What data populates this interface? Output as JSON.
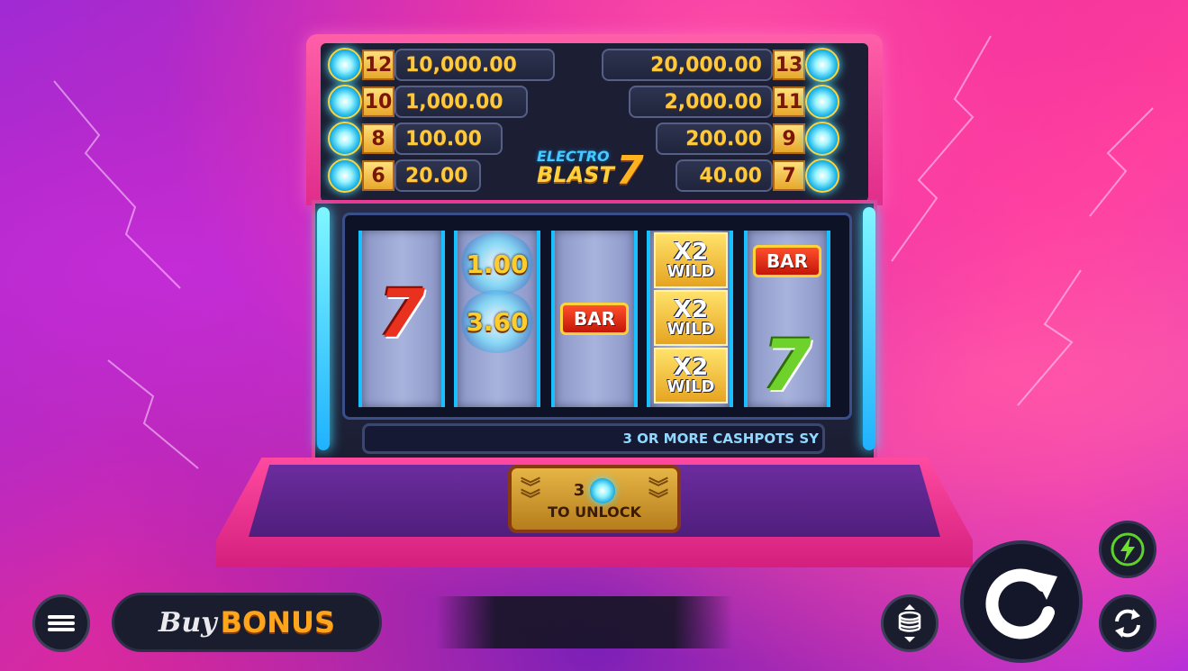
{
  "game": {
    "logo": {
      "line1": "ELECTRO",
      "line2": "BLAST",
      "line3": "7"
    }
  },
  "jackpots": {
    "left": [
      {
        "count": "12",
        "value": "10,000.00"
      },
      {
        "count": "10",
        "value": "1,000.00"
      },
      {
        "count": "8",
        "value": "100.00"
      },
      {
        "count": "6",
        "value": "20.00"
      }
    ],
    "right": [
      {
        "count": "13",
        "value": "20,000.00"
      },
      {
        "count": "11",
        "value": "2,000.00"
      },
      {
        "count": "9",
        "value": "200.00"
      },
      {
        "count": "7",
        "value": "40.00"
      }
    ]
  },
  "reels": {
    "reel1": {
      "symbol": "7"
    },
    "reel2": {
      "cash_top": "1.00",
      "cash_bottom": "3.60"
    },
    "reel3": {
      "symbol": "BAR"
    },
    "reel4": {
      "wild_multiplier": "X2",
      "wild_label": "WILD"
    },
    "reel5": {
      "bar": "BAR",
      "seven": "7"
    }
  },
  "ticker": {
    "text": "3 OR MORE CASHPOTS SY"
  },
  "unlock": {
    "count": "3",
    "label": "TO UNLOCK"
  },
  "controls": {
    "buy_bonus_buy": "Buy",
    "buy_bonus_bonus": "BONUS"
  },
  "colors": {
    "accent_pink": "#e63a94",
    "gold": "#ffc93c",
    "cyan": "#19c0ff"
  }
}
